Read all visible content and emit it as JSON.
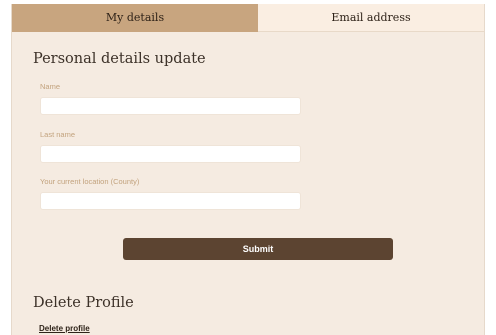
{
  "tabs": [
    {
      "label": "My details",
      "active": true
    },
    {
      "label": "Email address",
      "active": false
    }
  ],
  "personal": {
    "title": "Personal details update",
    "fields": [
      {
        "label": "Name",
        "value": "",
        "placeholder": ""
      },
      {
        "label": "Last name",
        "value": "",
        "placeholder": ""
      },
      {
        "label": "Your current location (County)",
        "value": "",
        "placeholder": ""
      }
    ],
    "submit_label": "Submit"
  },
  "delete": {
    "title": "Delete Profile",
    "link_label": "Delete profile"
  },
  "colors": {
    "active_tab": "#c8a57f",
    "inactive_tab": "#faeee2",
    "panel_background": "#f5ebe1",
    "submit_button": "#5c4431",
    "field_label": "#c2a27d"
  }
}
